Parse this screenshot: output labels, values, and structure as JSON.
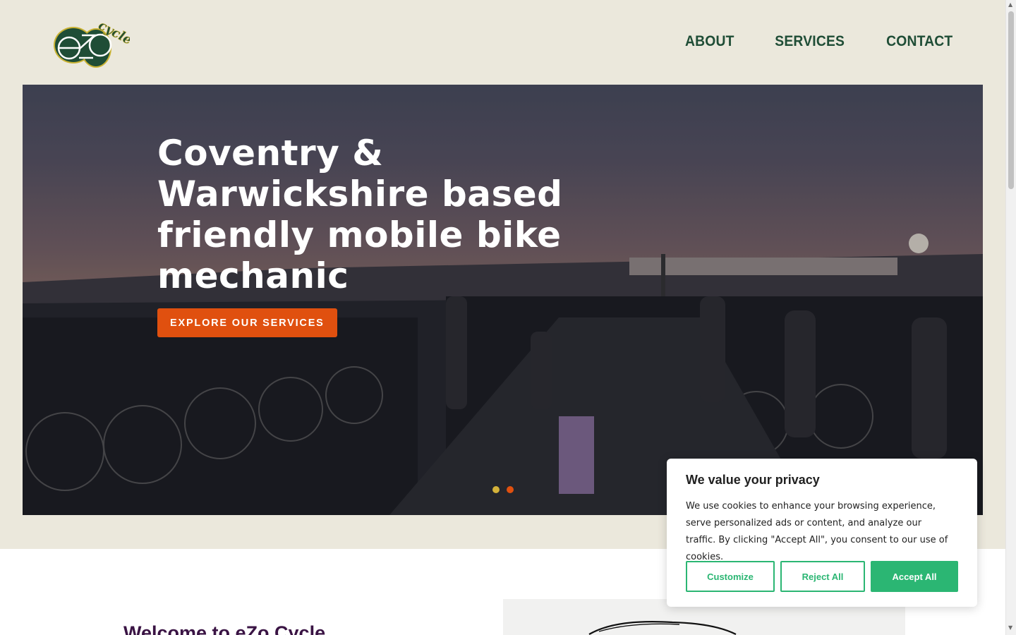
{
  "header": {
    "logo_text": "eZo Cycle",
    "nav": [
      {
        "label": "ABOUT"
      },
      {
        "label": "SERVICES"
      },
      {
        "label": "CONTACT"
      }
    ]
  },
  "hero": {
    "headline": "Coventry & Warwickshire based friendly mobile bike mechanic",
    "cta_label": "EXPLORE OUR SERVICES",
    "slides": 2,
    "active_slide": 2,
    "dot_colors": [
      "#d4b23a",
      "#e0500f"
    ]
  },
  "welcome": {
    "title": "Welcome to eZo Cycle"
  },
  "cookie_banner": {
    "title": "We value your privacy",
    "body": "We use cookies to enhance your browsing experience, serve personalized ads or content, and analyze our traffic. By clicking \"Accept All\", you consent to our use of cookies.",
    "customize_label": "Customize",
    "reject_label": "Reject All",
    "accept_label": "Accept All"
  },
  "colors": {
    "brand_green": "#1f4d36",
    "accent_orange": "#e0500f",
    "cookie_green": "#2bb673",
    "header_bg": "#ebe8dc",
    "welcome_purple": "#3a1444"
  }
}
